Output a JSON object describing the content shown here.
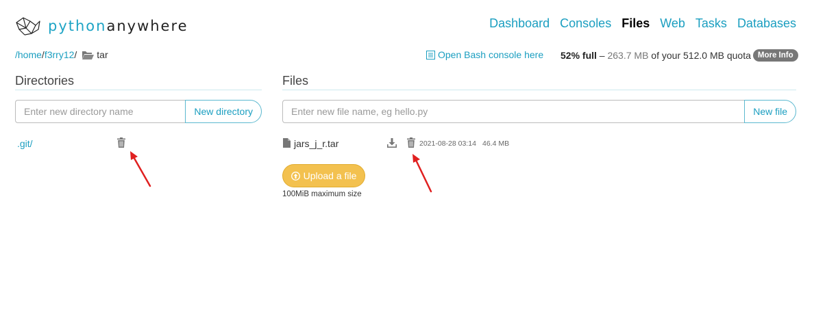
{
  "logo": {
    "part1": "python",
    "part2": "anywhere"
  },
  "nav": [
    {
      "label": "Dashboard",
      "active": false
    },
    {
      "label": "Consoles",
      "active": false
    },
    {
      "label": "Files",
      "active": true
    },
    {
      "label": "Web",
      "active": false
    },
    {
      "label": "Tasks",
      "active": false
    },
    {
      "label": "Databases",
      "active": false
    }
  ],
  "breadcrumb": {
    "home": "/home",
    "sep1": "/",
    "user": "f3rry12",
    "sep2": "/",
    "current": "tar"
  },
  "bash_link": "Open Bash console here",
  "quota": {
    "percent": "52% full",
    "dash": " – ",
    "used": "263.7 MB",
    "of_your": " of your ",
    "total": "512.0 MB quota",
    "more_info": "More Info"
  },
  "directories": {
    "title": "Directories",
    "input_placeholder": "Enter new directory name",
    "button": "New directory",
    "items": [
      {
        "name": ".git/"
      }
    ]
  },
  "files": {
    "title": "Files",
    "input_placeholder": "Enter new file name, eg hello.py",
    "button": "New file",
    "items": [
      {
        "name": "jars_j_r.tar",
        "modified": "2021-08-28 03:14",
        "size": "46.4 MB"
      }
    ],
    "upload_button": "Upload a file",
    "upload_note": "100MiB maximum size"
  },
  "colors": {
    "accent": "#1a9ec0",
    "upload": "#f3c14f",
    "annotation_arrow": "#e02020"
  },
  "icons": [
    "pythonanywhere-logo-icon",
    "folder-open-icon",
    "terminal-icon",
    "trash-icon",
    "file-icon",
    "download-icon",
    "upload-circle-icon"
  ]
}
